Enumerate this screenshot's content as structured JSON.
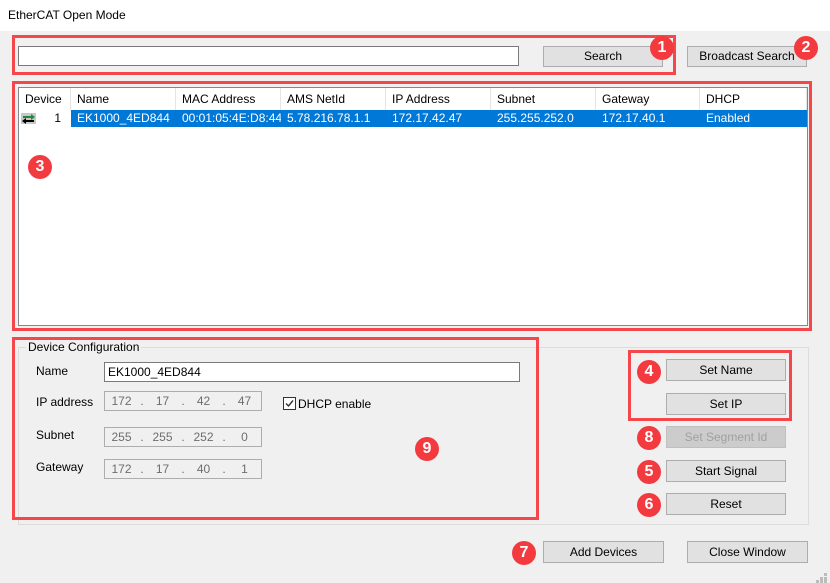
{
  "window": {
    "title": "EtherCAT Open Mode"
  },
  "search": {
    "input_value": "",
    "search_label": "Search",
    "broadcast_label": "Broadcast Search"
  },
  "device_list": {
    "columns": [
      "Device",
      "Name",
      "MAC Address",
      "AMS NetId",
      "IP Address",
      "Subnet",
      "Gateway",
      "DHCP"
    ],
    "rows": [
      {
        "device": "1",
        "icon": "network-device-icon",
        "name": "EK1000_4ED844",
        "mac": "00:01:05:4E:D8:44",
        "ams_netid": "5.78.216.78.1.1",
        "ip": "172.17.42.47",
        "subnet": "255.255.252.0",
        "gateway": "172.17.40.1",
        "dhcp": "Enabled",
        "selected": true
      }
    ]
  },
  "config": {
    "group_title": "Device Configuration",
    "name_label": "Name",
    "name_value": "EK1000_4ED844",
    "ip_label": "IP address",
    "ip": [
      "172",
      "17",
      "42",
      "47"
    ],
    "subnet_label": "Subnet",
    "subnet": [
      "255",
      "255",
      "252",
      "0"
    ],
    "gateway_label": "Gateway",
    "gateway": [
      "172",
      "17",
      "40",
      "1"
    ],
    "dhcp_label": "DHCP enable",
    "dhcp_checked": true
  },
  "actions": {
    "set_name": "Set Name",
    "set_ip": "Set IP",
    "set_segment_id": "Set Segment Id",
    "start_signal": "Start Signal",
    "reset": "Reset",
    "add_devices": "Add Devices",
    "close_window": "Close Window"
  },
  "annotations": {
    "badge_1": "1",
    "badge_2": "2",
    "badge_3": "3",
    "badge_4": "4",
    "badge_5": "5",
    "badge_6": "6",
    "badge_7": "7",
    "badge_8": "8",
    "badge_9": "9",
    "color": "#f23a3f"
  },
  "colors": {
    "selection": "#0078d7",
    "window_bg": "#f0f0f0",
    "annotation_border": "#f5474b"
  }
}
